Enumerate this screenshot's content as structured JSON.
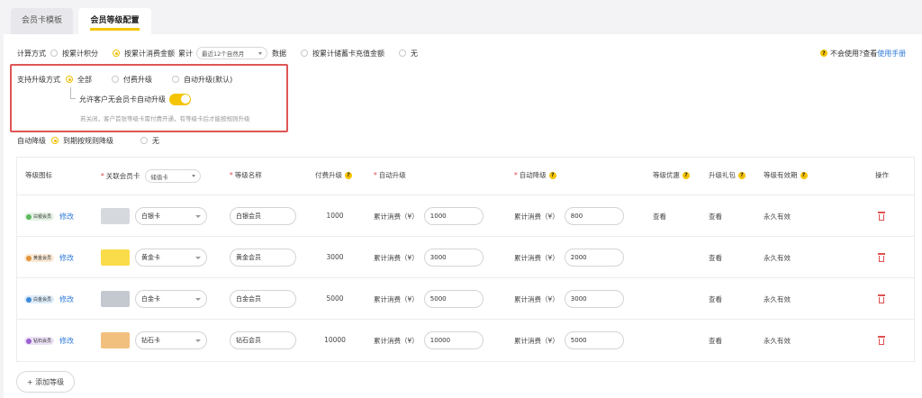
{
  "tabs": [
    {
      "label": "会员卡模板",
      "active": false
    },
    {
      "label": "会员等级配置",
      "active": true
    }
  ],
  "calc": {
    "label": "计算方式",
    "opt_points": "按累计积分",
    "opt_spend": "按累计消费金额",
    "accum_label": "累计",
    "period_value": "最近12个自然月",
    "data_label": "数据",
    "opt_stored": "按累计储蓄卡充值金额",
    "opt_none": "无",
    "selected": "spend"
  },
  "help": {
    "badge": "?",
    "text": "不会使用?查看",
    "link": "使用手册"
  },
  "upgrade": {
    "label": "支持升级方式",
    "opt_all": "全部",
    "opt_paid": "付费升级",
    "opt_auto": "自动升级(默认)",
    "allow_label": "允许客户无会员卡自动升级",
    "toggle_on": true,
    "hint": "若关闭，客户首张等级卡需付费开通，有等级卡后才能按规则升级"
  },
  "downgrade": {
    "label": "自动降级",
    "opt_rule": "到期按规则降级",
    "opt_none": "无"
  },
  "table": {
    "headers": {
      "icon": "等级图标",
      "card": "关联会员卡",
      "card_filter": "储值卡",
      "name": "等级名称",
      "paid": "付费升级",
      "auto_up": "自动升级",
      "auto_down": "自动降级",
      "benefit": "等级优惠",
      "gift": "升级礼包",
      "validity": "等级有效期",
      "action": "操作"
    },
    "help_badge": "?",
    "edit_label": "修改",
    "spend_label": "累计消费（¥）",
    "rows": [
      {
        "badge": "白银会员",
        "badge_bg": "#e4f3e4",
        "badge_dot": "#5cb85c",
        "swatch": "#d6d9de",
        "card": "白银卡",
        "name": "白银会员",
        "paid": "1000",
        "up": "1000",
        "down": "800",
        "benefit": "查看",
        "gift": "查看",
        "validity": "永久有效"
      },
      {
        "badge": "黄金会员",
        "badge_bg": "#fbe9d6",
        "badge_dot": "#e0953a",
        "swatch": "#fadc4b",
        "card": "黄金卡",
        "name": "黄金会员",
        "paid": "3000",
        "up": "3000",
        "down": "2000",
        "benefit": "",
        "gift": "查看",
        "validity": "永久有效"
      },
      {
        "badge": "白金会员",
        "badge_bg": "#dcebf9",
        "badge_dot": "#3c8ad8",
        "swatch": "#c4c9d0",
        "card": "白金卡",
        "name": "白金会员",
        "paid": "5000",
        "up": "5000",
        "down": "3000",
        "benefit": "",
        "gift": "查看",
        "validity": "永久有效"
      },
      {
        "badge": "钻石会员",
        "badge_bg": "#ece1f6",
        "badge_dot": "#9b5fd0",
        "swatch": "#f2c07e",
        "card": "钻石卡",
        "name": "钻石会员",
        "paid": "10000",
        "up": "10000",
        "down": "5000",
        "benefit": "",
        "gift": "查看",
        "validity": "永久有效"
      }
    ]
  },
  "add_button": "+ 添加等级",
  "colors": {
    "accent": "#f5c400",
    "link": "#2f7bd8",
    "danger": "#e05050",
    "highlight_box": "#e05555"
  }
}
